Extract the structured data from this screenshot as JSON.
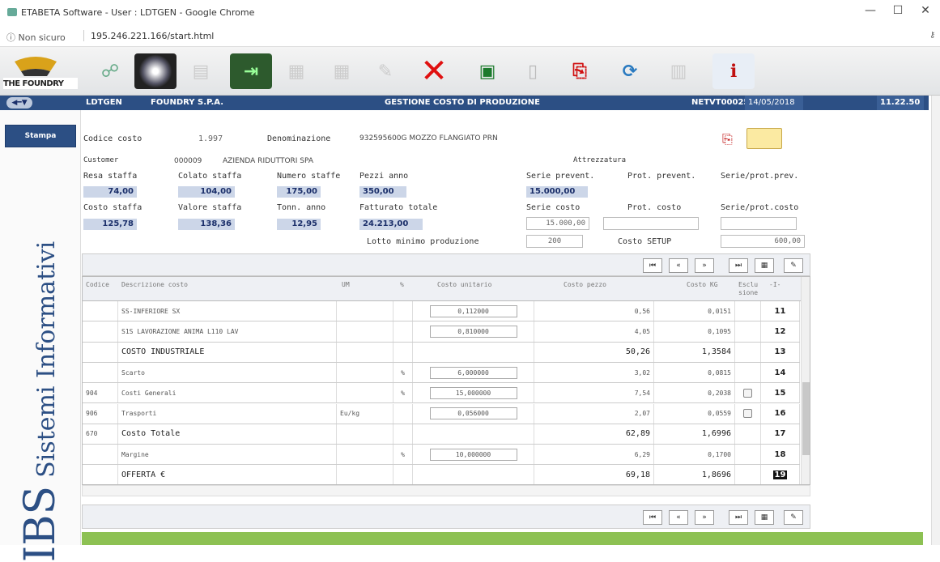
{
  "window": {
    "title": "ETABETA Software - User : LDTGEN - Google Chrome",
    "minimize": "—",
    "maximize": "☐",
    "close": "✕"
  },
  "address": {
    "security": "ⓘ Non sicuro",
    "url": "195.246.221.166/start.html"
  },
  "logo": {
    "text": "THE FOUNDRY"
  },
  "header": {
    "user": "LDTGEN",
    "company": "FOUNDRY S.P.A.",
    "module": "GESTIONE COSTO DI PRODUZIONE",
    "program": "NETVT00025",
    "date": "14/05/2018",
    "time": "11.22.50"
  },
  "sidebar": {
    "stampa": "Stampa",
    "brand_ibs": "IBS",
    "brand_rest": "Sistemi Informativi"
  },
  "form": {
    "codice_costo_label": "Codice costo",
    "codice_costo": "1.997",
    "denominazione_label": "Denominazione",
    "denominazione": "932595600G MOZZO FLANGIATO PRN",
    "customer_label": "Customer",
    "customer_code": "000009",
    "customer_name": "AZIENDA RIDUTTORI SPA",
    "attrezzatura_label": "Attrezzatura",
    "resa_staffa_label": "Resa  staffa",
    "resa_staffa": "74,00",
    "colato_staffa_label": "Colato staffa",
    "colato_staffa": "104,00",
    "numero_staffe_label": "Numero staffe",
    "numero_staffe": "175,00",
    "pezzi_anno_label": "Pezzi  anno",
    "pezzi_anno": "350,00",
    "serie_prevent_label": "Serie prevent.",
    "serie_prevent": "15.000,00",
    "prot_prevent_label": "Prot. prevent.",
    "serie_prot_prev_label": "Serie/prot.prev.",
    "costo_staffa_label": "Costo  staffa",
    "costo_staffa": "125,78",
    "valore_staffa_label": "Valore staffa",
    "valore_staffa": "138,36",
    "tonn_anno_label": "Tonn. anno",
    "tonn_anno": "12,95",
    "fatturato_totale_label": "Fatturato totale",
    "fatturato_totale": "24.213,00",
    "serie_costo_label": "Serie costo",
    "serie_costo": "15.000,00",
    "prot_costo_label": "Prot. costo",
    "serie_prot_costo_label": "Serie/prot.costo",
    "lotto_label": "Lotto minimo produzione",
    "lotto": "200",
    "costo_setup_label": "Costo SETUP",
    "costo_setup": "600,00"
  },
  "nav": {
    "first": "⏮",
    "prev": "«",
    "next": "»",
    "last": "⏭",
    "calc": "▦",
    "edit": "✎"
  },
  "grid": {
    "headers": {
      "codice": "Codice",
      "descrizione": "Descrizione costo",
      "um": "UM",
      "perc": "%",
      "costo_unitario": "Costo unitario",
      "costo_pezzo": "Costo pezzo",
      "costo_kg": "Costo KG",
      "esclusione": "Esclu sione",
      "n": "-I-"
    },
    "rows": [
      {
        "code": "",
        "desc": "SS-INFERIORE SX",
        "um": "",
        "perc": "",
        "unit": "0,112000",
        "pezzo": "0,56",
        "kg": "0,0151",
        "chk": false,
        "n": "11",
        "big": false
      },
      {
        "code": "",
        "desc": "S1S LAVORAZIONE ANIMA L110 LAV",
        "um": "",
        "perc": "",
        "unit": "0,810000",
        "pezzo": "4,05",
        "kg": "0,1095",
        "chk": false,
        "n": "12",
        "big": false
      },
      {
        "code": "",
        "desc": "COSTO INDUSTRIALE",
        "um": "",
        "perc": "",
        "unit": "",
        "pezzo": "50,26",
        "kg": "1,3584",
        "chk": false,
        "n": "13",
        "big": true
      },
      {
        "code": "",
        "desc": "Scarto",
        "um": "",
        "perc": "%",
        "unit": "6,000000",
        "pezzo": "3,02",
        "kg": "0,0815",
        "chk": false,
        "n": "14",
        "big": false
      },
      {
        "code": "904",
        "desc": "Costi Generali",
        "um": "",
        "perc": "%",
        "unit": "15,000000",
        "pezzo": "7,54",
        "kg": "0,2038",
        "chk": true,
        "n": "15",
        "big": false
      },
      {
        "code": "906",
        "desc": "Trasporti",
        "um": "Eu/kg",
        "perc": "",
        "unit": "0,056000",
        "pezzo": "2,07",
        "kg": "0,0559",
        "chk": true,
        "n": "16",
        "big": false
      },
      {
        "code": "670",
        "desc": "Costo Totale",
        "um": "",
        "perc": "",
        "unit": "",
        "pezzo": "62,89",
        "kg": "1,6996",
        "chk": false,
        "n": "17",
        "big": true
      },
      {
        "code": "",
        "desc": "Margine",
        "um": "",
        "perc": "%",
        "unit": "10,000000",
        "pezzo": "6,29",
        "kg": "0,1700",
        "chk": false,
        "n": "18",
        "big": false
      },
      {
        "code": "",
        "desc": "OFFERTA  €",
        "um": "",
        "perc": "",
        "unit": "",
        "pezzo": "69,18",
        "kg": "1,8696",
        "chk": false,
        "n": "19",
        "big": true
      }
    ]
  }
}
